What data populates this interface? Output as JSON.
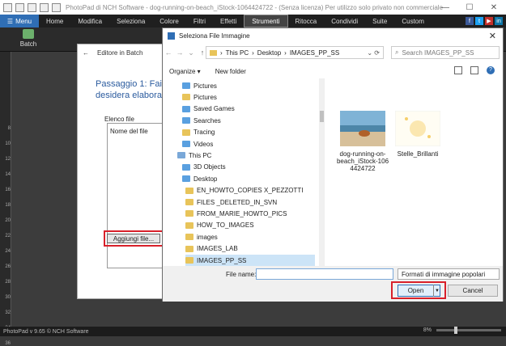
{
  "window": {
    "title": "PhotoPad di NCH Software - dog-running-on-beach_iStock-1064424722 - (Senza licenza) Per utilizzo solo privato non commerciale"
  },
  "menubar": {
    "menu_label": "Menu",
    "tabs": [
      "Home",
      "Modifica",
      "Seleziona",
      "Colore",
      "Filtri",
      "Effetti",
      "Strumenti",
      "Ritocca",
      "Condividi",
      "Suite",
      "Custom"
    ],
    "active_tab": "Strumenti"
  },
  "ribbon": {
    "batch_label": "Batch"
  },
  "ruler": {
    "ticks": [
      "8",
      "10",
      "12",
      "14",
      "16",
      "18",
      "20",
      "22",
      "24",
      "26",
      "28",
      "30",
      "32",
      "34",
      "36"
    ]
  },
  "statusbar": {
    "version": "PhotoPad v 9.65 © NCH Software",
    "zoom": "8%"
  },
  "batch_editor": {
    "title": "Editore in Batch",
    "step_line1": "Passaggio 1: Fai clic",
    "step_line2": "desidera elaborare.",
    "file_list_label": "Elenco file",
    "column_header": "Nome del file",
    "add_button": "Aggiungi file..."
  },
  "dialog": {
    "title": "Seleziona File Immagine",
    "breadcrumb": [
      "This PC",
      "Desktop",
      "IMAGES_PP_SS"
    ],
    "search_placeholder": "Search IMAGES_PP_SS",
    "organize": "Organize ▾",
    "new_folder": "New folder",
    "tree": [
      {
        "label": "Pictures",
        "type": "blue",
        "indent": 2
      },
      {
        "label": "Pictures",
        "type": "yellow",
        "indent": 2
      },
      {
        "label": "Saved Games",
        "type": "blue",
        "indent": 2
      },
      {
        "label": "Searches",
        "type": "blue",
        "indent": 2
      },
      {
        "label": "Tracing",
        "type": "yellow",
        "indent": 2
      },
      {
        "label": "Videos",
        "type": "blue",
        "indent": 2
      },
      {
        "label": "This PC",
        "type": "pc",
        "indent": 1
      },
      {
        "label": "3D Objects",
        "type": "blue",
        "indent": 2
      },
      {
        "label": "Desktop",
        "type": "blue",
        "indent": 2
      },
      {
        "label": "EN_HOWTO_COPIES X_PEZZOTTI",
        "type": "yellow",
        "indent": 3
      },
      {
        "label": "FILES _DELETED_IN_SVN",
        "type": "yellow",
        "indent": 3
      },
      {
        "label": "FROM_MARIE_HOWTO_PICS",
        "type": "yellow",
        "indent": 3
      },
      {
        "label": "HOW_TO_IMAGES",
        "type": "yellow",
        "indent": 3
      },
      {
        "label": "images",
        "type": "yellow",
        "indent": 3
      },
      {
        "label": "IMAGES_LAB",
        "type": "yellow",
        "indent": 3
      },
      {
        "label": "IMAGES_PP_SS",
        "type": "yellow",
        "indent": 3,
        "selected": true
      }
    ],
    "files": [
      {
        "name": "dog-running-on-beach_iStock-1064424722",
        "lines": [
          "dog-running-on-",
          "beach_iStock-106",
          "4424722"
        ]
      },
      {
        "name": "Stelle_Brillanti",
        "lines": [
          "Stelle_Brillanti"
        ]
      }
    ],
    "file_name_label": "File name:",
    "file_name_value": "",
    "file_type": "Formati di immagine popolari",
    "open_label": "Open",
    "cancel_label": "Cancel"
  },
  "colors": {
    "accent": "#2f6eb5",
    "highlight": "#d8202a"
  }
}
